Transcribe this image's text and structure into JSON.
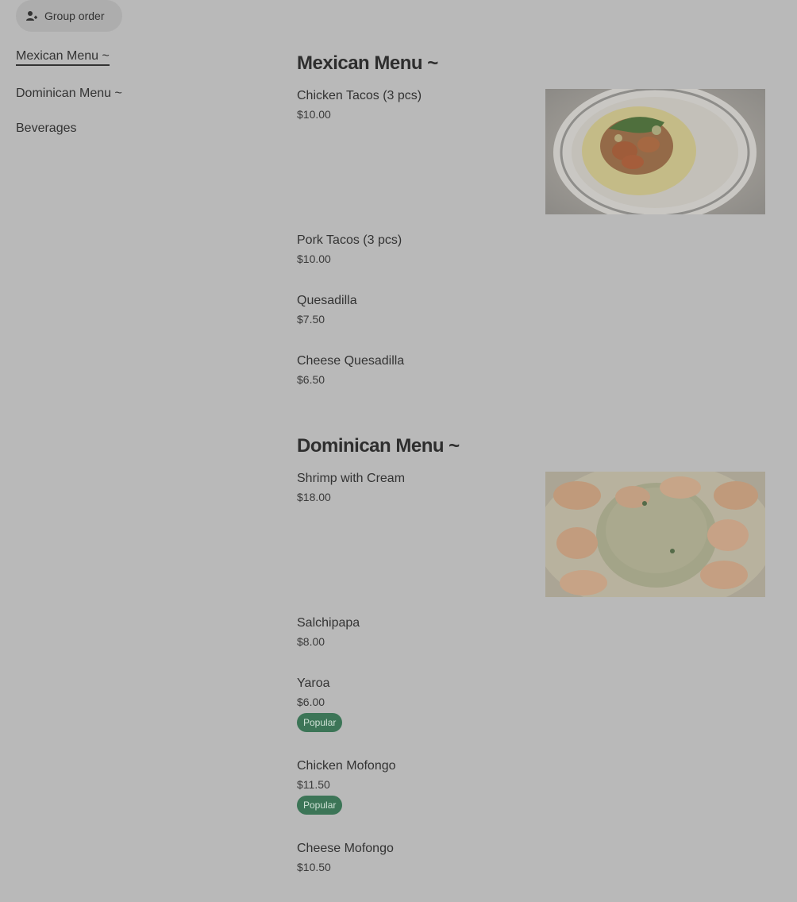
{
  "header": {
    "group_order_label": "Group order"
  },
  "sidebar": {
    "items": [
      {
        "label": "Mexican Menu ~"
      },
      {
        "label": "Dominican Menu ~"
      },
      {
        "label": "Beverages"
      }
    ]
  },
  "sections": [
    {
      "title": "Mexican Menu ~",
      "items": [
        {
          "name": "Chicken Tacos (3 pcs)",
          "price": "$10.00"
        },
        {
          "name": "Pork Tacos (3 pcs)",
          "price": "$10.00"
        },
        {
          "name": "Quesadilla",
          "price": "$7.50"
        },
        {
          "name": "Cheese Quesadilla",
          "price": "$6.50"
        }
      ]
    },
    {
      "title": "Dominican Menu ~",
      "items": [
        {
          "name": "Shrimp with Cream",
          "price": "$18.00"
        },
        {
          "name": "Salchipapa",
          "price": "$8.00"
        },
        {
          "name": "Yaroa",
          "price": "$6.00",
          "badge": "Popular"
        },
        {
          "name": "Chicken Mofongo",
          "price": "$11.50",
          "badge": "Popular"
        },
        {
          "name": "Cheese Mofongo",
          "price": "$10.50"
        }
      ]
    }
  ],
  "colors": {
    "background": "#b9b9b9",
    "badge": "#3c7557"
  }
}
